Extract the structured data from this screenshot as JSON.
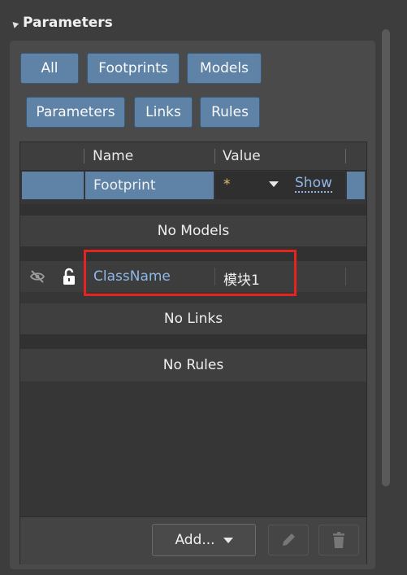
{
  "section": {
    "title": "Parameters"
  },
  "filters": {
    "row1": [
      "All",
      "Footprints",
      "Models"
    ],
    "row2": [
      "Parameters",
      "Links",
      "Rules"
    ]
  },
  "table": {
    "columns": {
      "name": "Name",
      "value": "Value"
    },
    "footprint": {
      "name": "Footprint",
      "value": "*",
      "show_link": "Show"
    },
    "empty_models": "No Models",
    "classname": {
      "name": "ClassName",
      "value": "模块1"
    },
    "empty_links": "No Links",
    "empty_rules": "No Rules"
  },
  "toolbar": {
    "add_label": "Add..."
  },
  "colors": {
    "selected_row": "#5e83a7",
    "link_text": "#8fb8e8",
    "highlight_box": "#e8231f"
  }
}
